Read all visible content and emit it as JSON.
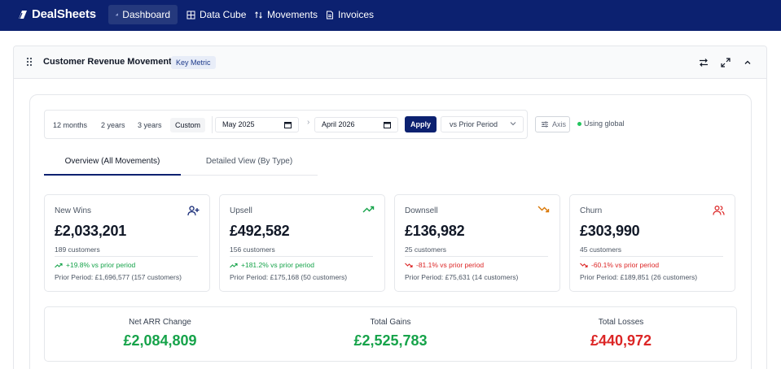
{
  "app": {
    "brand": "DealSheets"
  },
  "nav": [
    {
      "label": "Dashboard",
      "icon": "bar-chart-icon",
      "active": true
    },
    {
      "label": "Data Cube",
      "icon": "grid-icon",
      "active": false
    },
    {
      "label": "Movements",
      "icon": "up-down-arrows-icon",
      "active": false
    },
    {
      "label": "Invoices",
      "icon": "document-icon",
      "active": false
    }
  ],
  "panel": {
    "title": "Customer Revenue Movements",
    "badge": "Key Metric"
  },
  "filters": {
    "ranges": [
      "12 months",
      "2 years",
      "3 years",
      "Custom"
    ],
    "active_range": "Custom",
    "start": "May 2025",
    "end": "April 2026",
    "apply": "Apply",
    "compare": "vs Prior Period",
    "axis": "Axis",
    "global_status": "Using global"
  },
  "tabs": [
    {
      "label": "Overview (All Movements)",
      "active": true
    },
    {
      "label": "Detailed View (By Type)",
      "active": false
    }
  ],
  "cards": [
    {
      "label": "New Wins",
      "icon": "user-plus-icon",
      "value": "£2,033,201",
      "customers": "189 customers",
      "change": "+19.8% vs prior period",
      "direction": "up",
      "prior": "Prior Period: £1,696,577 (157 customers)",
      "icon_color": "#0c2170"
    },
    {
      "label": "Upsell",
      "icon": "trending-up-icon",
      "value": "£492,582",
      "customers": "156 customers",
      "change": "+181.2% vs prior period",
      "direction": "up",
      "prior": "Prior Period: £175,168 (50 customers)",
      "icon_color": "#16a34a"
    },
    {
      "label": "Downsell",
      "icon": "trending-down-icon",
      "value": "£136,982",
      "customers": "25 customers",
      "change": "-81.1% vs prior period",
      "direction": "down",
      "prior": "Prior Period: £75,631 (14 customers)",
      "icon_color": "#d97706"
    },
    {
      "label": "Churn",
      "icon": "users-icon",
      "value": "£303,990",
      "customers": "45 customers",
      "change": "-60.1% vs prior period",
      "direction": "down",
      "prior": "Prior Period: £189,851 (26 customers)",
      "icon_color": "#dc2626"
    }
  ],
  "summary": [
    {
      "label": "Net ARR Change",
      "value": "£2,084,809",
      "color": "#16a34a"
    },
    {
      "label": "Total Gains",
      "value": "£2,525,783",
      "color": "#16a34a"
    },
    {
      "label": "Total Losses",
      "value": "£440,972",
      "color": "#dc2626"
    }
  ],
  "colors": {
    "nav_bg": "#0c2170",
    "positive": "#16a34a",
    "negative": "#dc2626"
  }
}
